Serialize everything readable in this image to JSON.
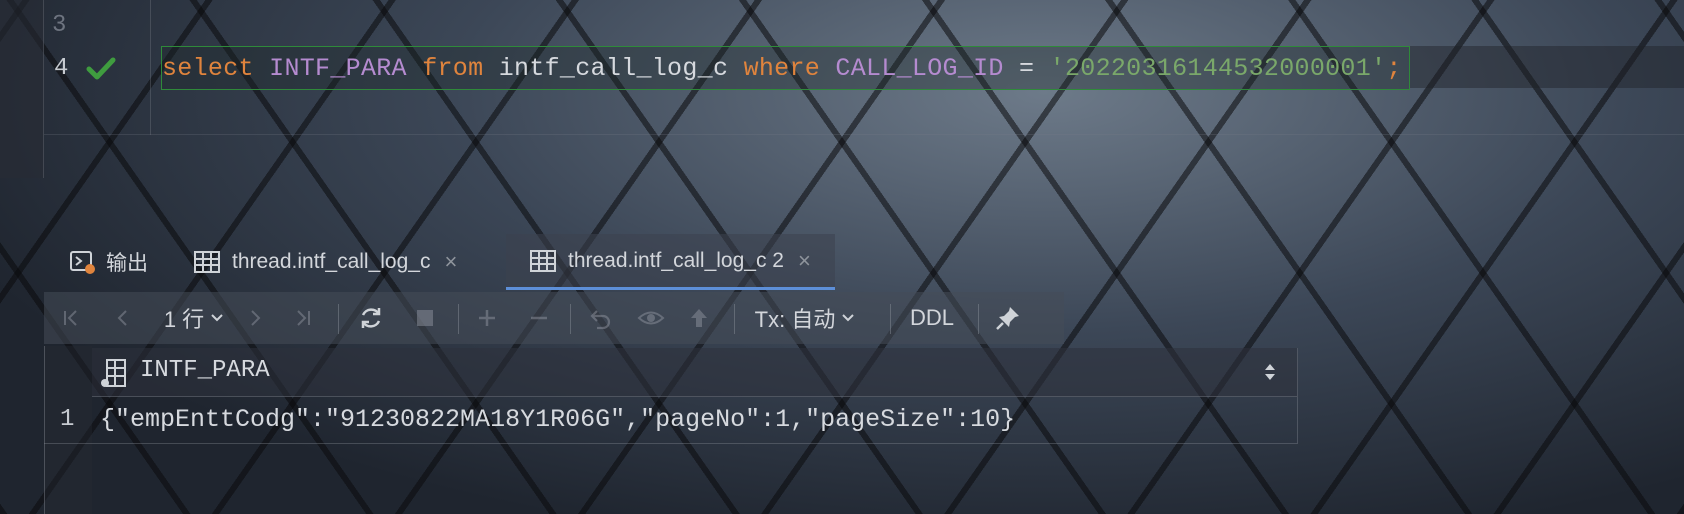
{
  "editor": {
    "line3": "3",
    "line4": "4",
    "sql": {
      "kw_select": "select",
      "col1": "INTF_PARA",
      "kw_from": "from",
      "table": "intf_call_log_c",
      "kw_where": "where",
      "col2": "CALL_LOG_ID",
      "op": "=",
      "value": "'20220316144532000001'",
      "end": ";"
    }
  },
  "tabs": [
    {
      "label": "输出",
      "icon": "output-icon"
    },
    {
      "label": "thread.intf_call_log_c",
      "icon": "table-icon",
      "close": "×"
    },
    {
      "label": "thread.intf_call_log_c 2",
      "icon": "table-icon",
      "close": "×",
      "active": true
    }
  ],
  "toolbar": {
    "rows_label": "1 行",
    "tx_label": "Tx: 自动",
    "ddl_label": "DDL"
  },
  "result": {
    "column": "INTF_PARA",
    "rows": [
      {
        "num": "1",
        "value": "{\"empEnttCodg\":\"91230822MA18Y1R06G\",\"pageNo\":1,\"pageSize\":10}"
      }
    ]
  },
  "colors": {
    "keyword": "#e0843d",
    "column": "#b58bd0",
    "string": "#7aa86a",
    "accent": "#5d8fd8",
    "ok": "#3f9c3f"
  }
}
